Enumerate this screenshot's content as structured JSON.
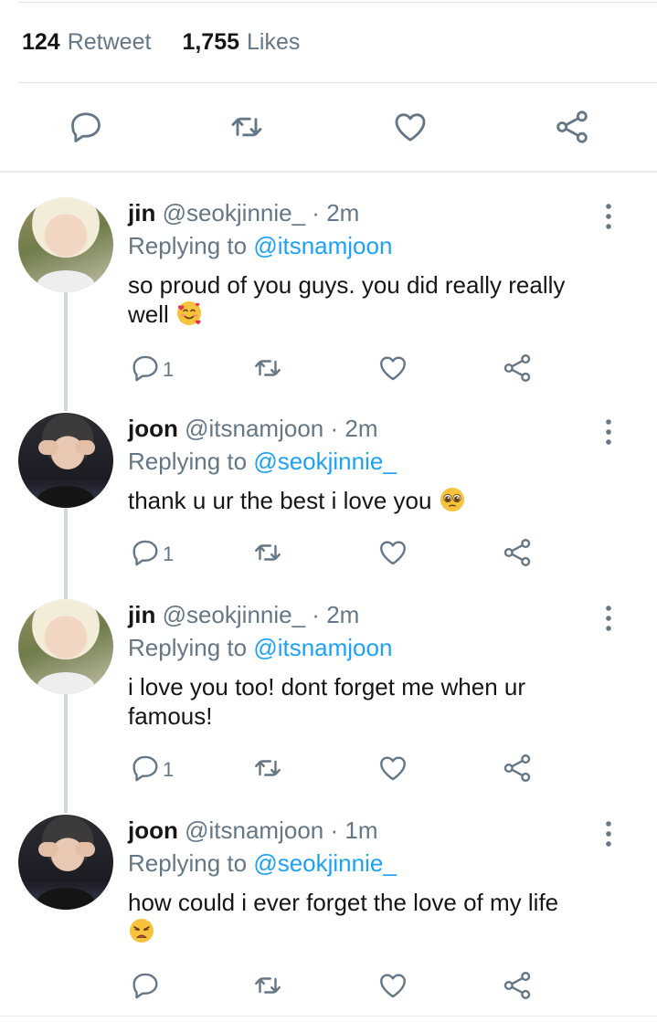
{
  "stats": {
    "retweets_count": "124",
    "retweets_label": "Retweet",
    "likes_count": "1,755",
    "likes_label": "Likes"
  },
  "main_actions": [
    "reply-icon",
    "retweet-icon",
    "like-icon",
    "share-icon"
  ],
  "tweets": [
    {
      "author_name": "jin",
      "author_handle": "@seokjinnie_",
      "separator": "·",
      "time": "2m",
      "replying_label": "Replying to",
      "replying_to": "@itsnamjoon",
      "text": "so proud of you guys. you did really really well",
      "emoji": "smiling-face-with-hearts",
      "reply_count": "1",
      "avatar": "jin-avatar"
    },
    {
      "author_name": "joon",
      "author_handle": "@itsnamjoon",
      "separator": "·",
      "time": "2m",
      "replying_label": "Replying to",
      "replying_to": "@seokjinnie_",
      "text": "thank u ur the best i love you",
      "emoji": "pleading-face",
      "reply_count": "1",
      "avatar": "joon-avatar"
    },
    {
      "author_name": "jin",
      "author_handle": "@seokjinnie_",
      "separator": "·",
      "time": "2m",
      "replying_label": "Replying to",
      "replying_to": "@itsnamjoon",
      "text": "i love you too! dont forget me when ur famous!",
      "emoji": "",
      "reply_count": "1",
      "avatar": "jin-avatar"
    },
    {
      "author_name": "joon",
      "author_handle": "@itsnamjoon",
      "separator": "·",
      "time": "1m",
      "replying_label": "Replying to",
      "replying_to": "@seokjinnie_",
      "text": "how could i ever forget the love of my life",
      "emoji": "weary-face",
      "reply_count": "",
      "avatar": "joon-avatar"
    }
  ],
  "colors": {
    "accent": "#1da1f2",
    "muted": "#657786",
    "icon": "#657786",
    "divider": "#e6ecf0"
  }
}
